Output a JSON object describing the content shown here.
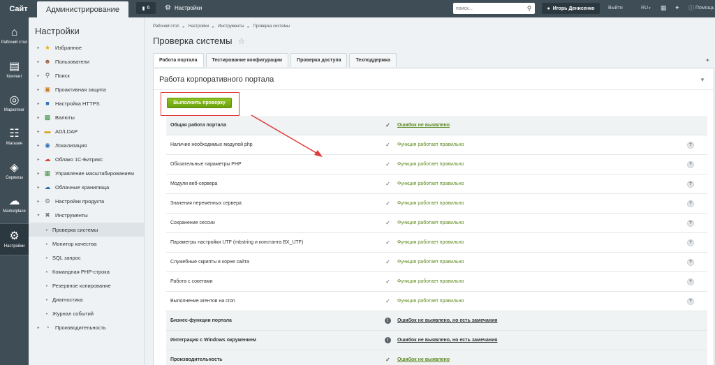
{
  "topbar": {
    "site_label": "Сайт",
    "admin_label": "Администрирование",
    "notifications_count": "6",
    "settings_label": "Настройки",
    "search_placeholder": "поиск...",
    "user_name": "Игорь Денисенко",
    "logout_label": "Выйти",
    "lang_label": "RU",
    "help_label": "Помощь"
  },
  "leftmenu": {
    "items": [
      {
        "label": "Рабочий стол",
        "icon": "home-icon"
      },
      {
        "label": "Контент",
        "icon": "document-icon"
      },
      {
        "label": "Маркетинг",
        "icon": "target-icon"
      },
      {
        "label": "Магазин",
        "icon": "cart-icon"
      },
      {
        "label": "Сервисы",
        "icon": "layers-icon"
      },
      {
        "label": "Marketplace",
        "icon": "cloud-upload-icon"
      },
      {
        "label": "Настройки",
        "icon": "gear-icon"
      }
    ]
  },
  "panel": {
    "title": "Настройки",
    "items": [
      {
        "label": "Избранное"
      },
      {
        "label": "Пользователи"
      },
      {
        "label": "Поиск"
      },
      {
        "label": "Проактивная защита"
      },
      {
        "label": "Настройка HTTPS"
      },
      {
        "label": "Валюты"
      },
      {
        "label": "AD/LDAP"
      },
      {
        "label": "Локализация"
      },
      {
        "label": "Облако 1С-Битрикс"
      },
      {
        "label": "Управление масштабированием"
      },
      {
        "label": "Облачные хранилища"
      },
      {
        "label": "Настройки продукта"
      },
      {
        "label": "Инструменты"
      }
    ],
    "subitems": [
      {
        "label": "Проверка системы"
      },
      {
        "label": "Монитор качества"
      },
      {
        "label": "SQL запрос"
      },
      {
        "label": "Командная PHP-строка"
      },
      {
        "label": "Резервное копирование"
      },
      {
        "label": "Диагностика"
      },
      {
        "label": "Журнал событий"
      }
    ],
    "last_item": "Производительность"
  },
  "content": {
    "breadcrumb": [
      "Рабочий стол",
      "Настройки",
      "Инструменты",
      "Проверка системы"
    ],
    "title": "Проверка системы",
    "tabs": [
      "Работа портала",
      "Тестирование конфигурации",
      "Проверка доступа",
      "Техподдержка"
    ],
    "box_title": "Работа корпоративного портала",
    "run_button": "Выполнить проверку",
    "rows": [
      {
        "name": "Общая работа портала",
        "status": "Ошибок не выявлено",
        "group": true
      },
      {
        "name": "Наличие необходимых модулей php",
        "status": "Функция работает правильно"
      },
      {
        "name": "Обязательные параметры PHP",
        "status": "Функция работает правильно"
      },
      {
        "name": "Модули веб-сервера",
        "status": "Функция работает правильно"
      },
      {
        "name": "Значения переменных сервера",
        "status": "Функция работает правильно"
      },
      {
        "name": "Сохранение сессии",
        "status": "Функция работает правильно"
      },
      {
        "name": "Параметры настройки UTF (mbstring и константа BX_UTF)",
        "status": "Функция работает правильно"
      },
      {
        "name": "Служебные скрипты в корне сайта",
        "status": "Функция работает правильно"
      },
      {
        "name": "Работа с сокетами",
        "status": "Функция работает правильно"
      },
      {
        "name": "Выполнение агентов на cron",
        "status": "Функция работает правильно"
      },
      {
        "name": "Бизнес-функции портала",
        "status": "Ошибок не выявлено, но есть замечания",
        "group": true
      },
      {
        "name": "Интеграция с Windows окружением",
        "status": "Ошибок не выявлено, но есть замечания",
        "group": true
      },
      {
        "name": "Производительность",
        "status": "Ошибок не выявлено",
        "group": true
      }
    ]
  },
  "colors": {
    "topbar": "#3f4d56",
    "accent_green": "#6aa00f",
    "annotation_red": "#e03b3b",
    "status_green": "#5d8a1f"
  }
}
